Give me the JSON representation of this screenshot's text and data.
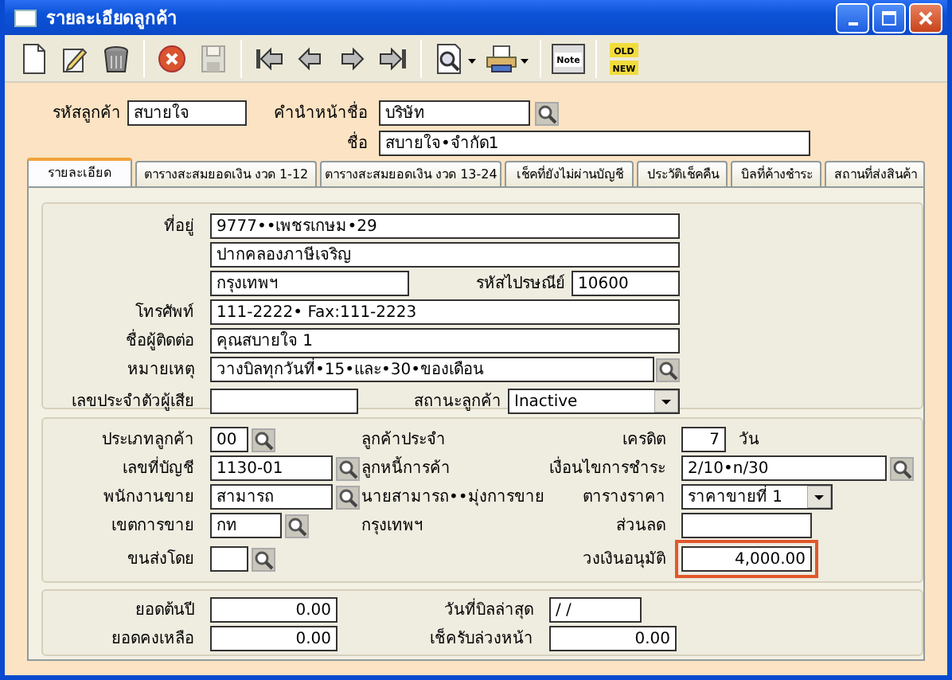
{
  "window": {
    "title": "รายละเอียดลูกค้า"
  },
  "toolbar": [
    {
      "disabled": false
    },
    {
      "disabled": false
    },
    {
      "disabled": false
    },
    {
      "disabled": false
    },
    {
      "disabled": true
    },
    {
      "disabled": false
    },
    {
      "disabled": false
    },
    {
      "disabled": false
    },
    {
      "disabled": false
    },
    {
      "disabled": false
    },
    {
      "disabled": false
    },
    {
      "disabled": false,
      "icon_text": [
        "Note"
      ]
    },
    {
      "disabled": false,
      "icon_text": [
        "OLD",
        "NEW"
      ]
    }
  ],
  "header": {
    "customer_code": {
      "label": "รหัสลูกค้า",
      "value": "สบายใจ"
    },
    "prefix": {
      "label": "คำนำหน้าชื่อ",
      "value": "บริษัท"
    },
    "name": {
      "label": "ชื่อ",
      "value": "สบายใจ•จำกัด1"
    }
  },
  "tabs": [
    {
      "label": "รายละเอียด",
      "selected": true
    },
    {
      "label": "ตารางสะสมยอดเงิน งวด  1-12",
      "selected": false
    },
    {
      "label": "ตารางสะสมยอดเงิน งวด 13-24",
      "selected": false
    },
    {
      "label": "เช็คที่ยังไม่ผ่านบัญชี",
      "selected": false
    },
    {
      "label": "ประวัติเช็คคืน",
      "selected": false
    },
    {
      "label": "บิลที่ค้างชำระ",
      "selected": false
    },
    {
      "label": "สถานที่ส่งสินค้า",
      "selected": false
    }
  ],
  "details": {
    "address": {
      "label": "ที่อยู่",
      "lines": [
        "9777••เพชรเกษม•29",
        "ปากคลองภาษีเจริญ",
        "กรุงเทพฯ"
      ]
    },
    "postal_code": {
      "label": "รหัสไปรษณีย์",
      "value": "10600"
    },
    "phone": {
      "label": "โทรศัพท์",
      "value": "111-2222• Fax:111-2223"
    },
    "contact": {
      "label": "ชื่อผู้ติดต่อ",
      "value": "คุณสบายใจ 1"
    },
    "note": {
      "label": "หมายเหตุ",
      "value": "วางบิลทุกวันที่•15•และ•30•ของเดือน"
    },
    "tax_id": {
      "label": "เลขประจำตัวผู้เสีย"
    },
    "status": {
      "label": "สถานะลูกค้า",
      "value": "Inactive"
    }
  },
  "account": {
    "customer_type": {
      "label": "ประเภทลูกค้า",
      "value": "00",
      "description": "ลูกค้าประจำ"
    },
    "account_no": {
      "label": "เลขที่บัญชี",
      "value": "1130-01",
      "description": "ลูกหนี้การค้า"
    },
    "salesperson": {
      "label": "พนักงานขาย",
      "value": "สามารถ",
      "description": "นายสามารถ••มุ่งการขาย"
    },
    "sales_area": {
      "label": "เขตการขาย",
      "value": "กท",
      "description": "กรุงเทพฯ"
    },
    "shipping": {
      "label": "ขนส่งโดย"
    },
    "credit": {
      "label": "เครดิต",
      "value": "7",
      "unit": "วัน"
    },
    "payment_terms": {
      "label": "เงื่อนไขการชำระ",
      "value": "2/10•n/30"
    },
    "price_table": {
      "label": "ตารางราคา",
      "value": "ราคาขายที่ 1"
    },
    "discount": {
      "label": "ส่วนลด"
    },
    "credit_limit": {
      "label": "วงเงินอนุมัติ",
      "value": "4,000.00",
      "highlighted": true
    }
  },
  "balances": {
    "opening": {
      "label": "ยอดต้นปี",
      "value": "0.00"
    },
    "balance": {
      "label": "ยอดคงเหลือ",
      "value": "0.00"
    },
    "last_bill_date": {
      "label": "วันที่บิลล่าสุด",
      "value": "/ /"
    },
    "advance_cheque": {
      "label": "เช็ครับล่วงหน้า",
      "value": "0.00"
    }
  }
}
